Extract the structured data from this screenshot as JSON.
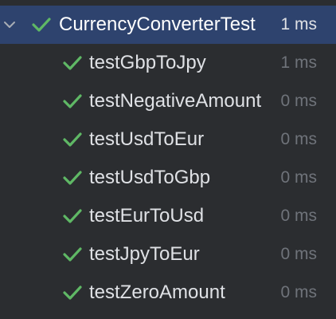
{
  "colors": {
    "background": "#2b2d30",
    "selection": "#2e436e",
    "pass_green": "#5fb865",
    "text": "#dfe1e5",
    "muted": "#6f737a"
  },
  "suite": {
    "name": "CurrencyConverterTest",
    "time": "1 ms",
    "status": "passed",
    "expanded": true,
    "chevron_icon": "chevron-down-icon",
    "status_icon": "check-icon"
  },
  "tests": [
    {
      "name": "testGbpToJpy",
      "time": "1 ms",
      "status": "passed"
    },
    {
      "name": "testNegativeAmount",
      "time": "0 ms",
      "status": "passed"
    },
    {
      "name": "testUsdToEur",
      "time": "0 ms",
      "status": "passed"
    },
    {
      "name": "testUsdToGbp",
      "time": "0 ms",
      "status": "passed"
    },
    {
      "name": "testEurToUsd",
      "time": "0 ms",
      "status": "passed"
    },
    {
      "name": "testJpyToEur",
      "time": "0 ms",
      "status": "passed"
    },
    {
      "name": "testZeroAmount",
      "time": "0 ms",
      "status": "passed"
    }
  ]
}
